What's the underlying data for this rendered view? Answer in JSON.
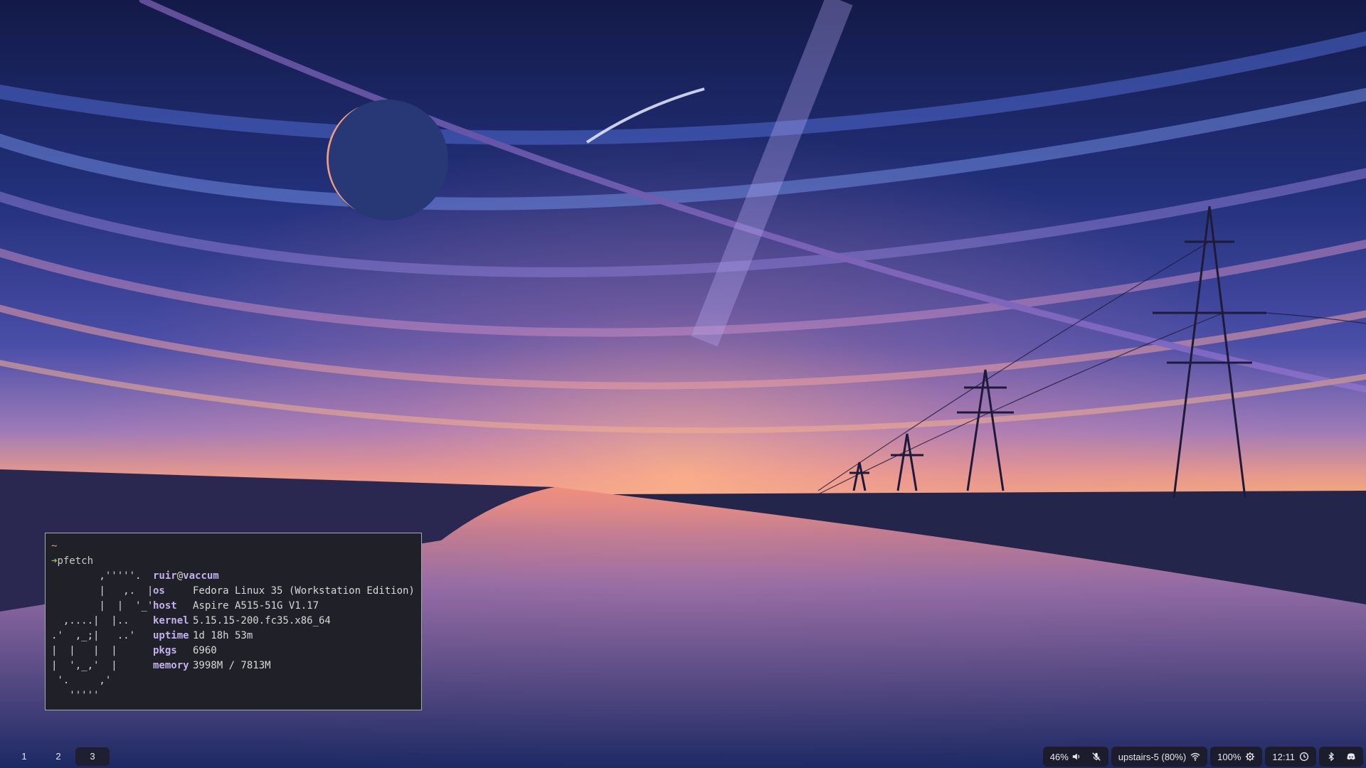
{
  "terminal": {
    "tilde": "~",
    "prompt_arrow": "➜",
    "command": "pfetch",
    "logo_lines": [
      "        ,'''''.",
      "        |   ,.  |",
      "        |  |  '_'",
      "  ,....|  |..",
      ".'  ,_;|   ..'",
      "|  |   |  |",
      "|  ',_,'  |",
      " '.     ,'",
      "   '''''"
    ],
    "user": "ruir",
    "at": "@",
    "hostname": "vaccum",
    "info": [
      {
        "key": "os",
        "value": "Fedora Linux 35 (Workstation Edition)"
      },
      {
        "key": "host",
        "value": "Aspire A515-51G V1.17"
      },
      {
        "key": "kernel",
        "value": "5.15.15-200.fc35.x86_64"
      },
      {
        "key": "uptime",
        "value": "1d 18h 53m"
      },
      {
        "key": "pkgs",
        "value": "6960"
      },
      {
        "key": "memory",
        "value": "3998M / 7813M"
      }
    ]
  },
  "bar": {
    "workspaces": [
      {
        "label": "1",
        "active": false
      },
      {
        "label": "2",
        "active": false
      },
      {
        "label": "3",
        "active": true
      }
    ],
    "volume": "46%",
    "volume_icon": "speaker-icon",
    "mic_icon": "mic-muted-icon",
    "network": "upstairs-5 (80%)",
    "network_icon": "wifi-icon",
    "cpu": "100%",
    "cpu_icon": "gear-icon",
    "clock": "12:11",
    "clock_icon": "clock-icon",
    "bluetooth_icon": "bluetooth-icon",
    "discord_icon": "discord-icon"
  },
  "colors": {
    "terminal_bg": "#202128",
    "accent_purple": "#c4b0ee",
    "prompt_green": "#8ec06c",
    "bar_module_bg": "#1b1c2c"
  }
}
